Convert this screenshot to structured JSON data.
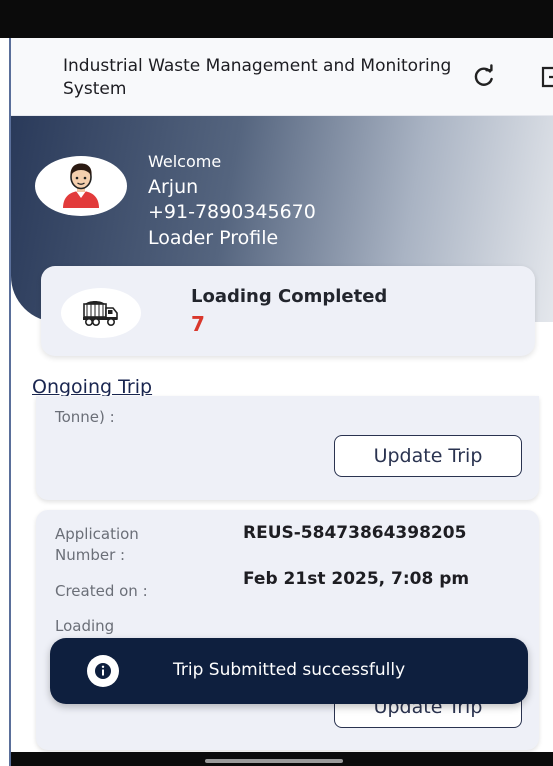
{
  "app_bar": {
    "title": "Industrial Waste Management and Monitoring System",
    "refresh_icon": "refresh-icon",
    "logout_icon": "logout-icon"
  },
  "profile": {
    "welcome": "Welcome",
    "name": "Arjun",
    "phone": "+91-7890345670",
    "role": "Loader Profile",
    "avatar_icon": "user-avatar-icon"
  },
  "stats": {
    "label": "Loading Completed",
    "value": "7",
    "icon": "dump-truck-icon"
  },
  "ongoing": {
    "section_title": "Ongoing Trip",
    "trips": [
      {
        "cut_label": "Tonne) :",
        "update_label": "Update Trip"
      },
      {
        "application_number_label": "Application Number :",
        "application_number": "REUS-58473864398205",
        "created_on_label": "Created on :",
        "created_on": "Feb 21st 2025, 7:08 pm",
        "loading_label": "Loading",
        "update_label": "Update Trip"
      }
    ]
  },
  "toast": {
    "message": "Trip Submitted successfully",
    "icon": "info-icon"
  },
  "colors": {
    "accent_dark": "#0e1f3e",
    "stat_value": "#d9372c",
    "card_bg": "#eef0f7"
  }
}
